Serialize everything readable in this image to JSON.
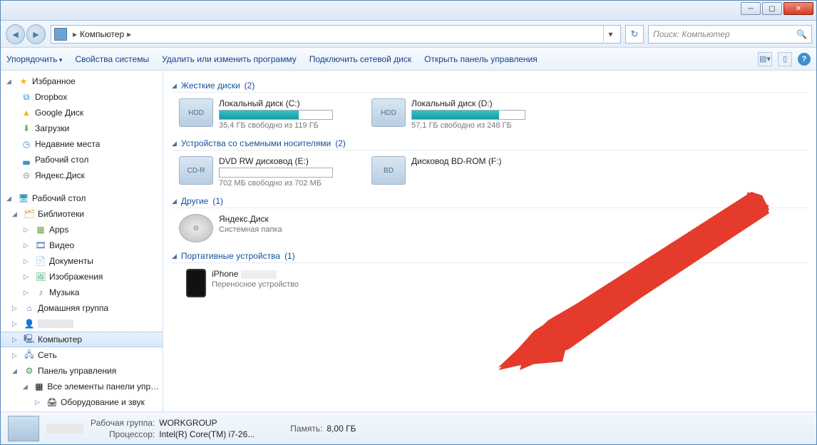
{
  "breadcrumb": {
    "root_label": "Компьютер"
  },
  "search": {
    "placeholder": "Поиск: Компьютер"
  },
  "toolbar": {
    "organize": "Упорядочить",
    "system_props": "Свойства системы",
    "uninstall": "Удалить или изменить программу",
    "map_drive": "Подключить сетевой диск",
    "control_panel": "Открыть панель управления"
  },
  "sidebar": {
    "favorites": "Избранное",
    "dropbox": "Dropbox",
    "gdrive": "Google Диск",
    "downloads": "Загрузки",
    "recent": "Недавние места",
    "desktop_fav": "Рабочий стол",
    "yandex": "Яндекс.Диск",
    "desktop": "Рабочий стол",
    "libraries": "Библиотеки",
    "apps": "Apps",
    "videos": "Видео",
    "documents": "Документы",
    "pictures": "Изображения",
    "music": "Музыка",
    "homegroup": "Домашняя группа",
    "user": " ",
    "computer": "Компьютер",
    "network": "Сеть",
    "cpanel": "Панель управления",
    "cpl_all": "Все элементы панели управле",
    "cpl_hw": "Оборудование и звук"
  },
  "groups": {
    "hdd": {
      "title": "Жесткие диски",
      "count": "(2)"
    },
    "removable": {
      "title": "Устройства со съемными носителями",
      "count": "(2)"
    },
    "other": {
      "title": "Другие",
      "count": "(1)"
    },
    "portable": {
      "title": "Портативные устройства",
      "count": "(1)"
    }
  },
  "drives": {
    "c": {
      "name": "Локальный диск (C:)",
      "sub": "35,4 ГБ свободно из 119 ГБ",
      "fill": 70
    },
    "d": {
      "name": "Локальный диск (D:)",
      "sub": "57,1 ГБ свободно из 248 ГБ",
      "fill": 77
    },
    "e": {
      "name": "DVD RW дисковод (E:)",
      "sub": "702 МБ свободно из 702 МБ",
      "fill": 0
    },
    "f": {
      "name": "Дисковод BD-ROM (F:)",
      "sub": ""
    },
    "ydisk": {
      "name": "Яндекс.Диск",
      "sub": "Системная папка"
    },
    "iphone": {
      "name": "iPhone",
      "sub": "Переносное устройство"
    }
  },
  "status": {
    "workgroup_label": "Рабочая группа:",
    "workgroup_val": "WORKGROUP",
    "cpu_label": "Процессор:",
    "cpu_val": "Intel(R) Core(TM) i7-26...",
    "mem_label": "Память:",
    "mem_val": "8,00 ГБ"
  }
}
